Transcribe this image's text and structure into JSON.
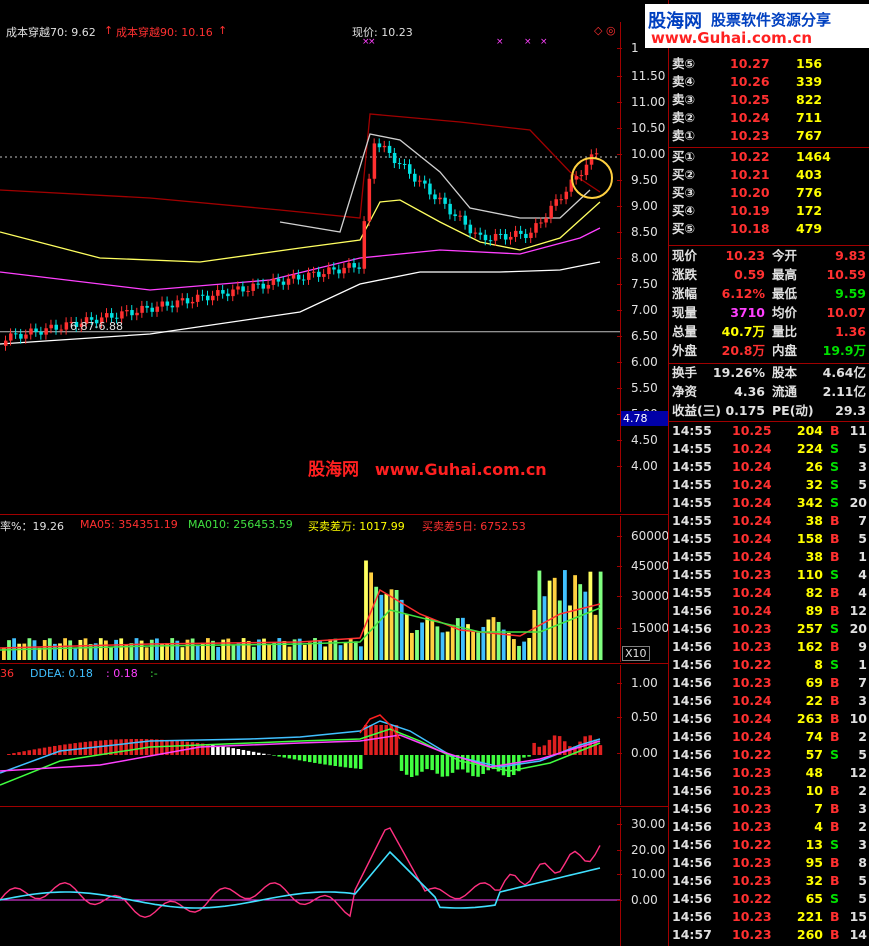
{
  "price_header": {
    "cost70": "成本穿越70: 9.62",
    "cost90": "成本穿越90: 10.16",
    "current": "现价: 10.23",
    "arrow": "↑"
  },
  "price_axis": [
    "1",
    "11.50",
    "11.00",
    "10.50",
    "10.00",
    "9.50",
    "9.00",
    "8.50",
    "8.00",
    "7.50",
    "7.00",
    "6.50",
    "6.00",
    "5.50",
    "5.00",
    "4.50",
    "4.00"
  ],
  "price_badge": "4.78",
  "low_label": "6.87-6.88",
  "watermark": {
    "brand": "股海网",
    "url": "www.Guhai.com.cn"
  },
  "logo": {
    "brand": "股海网",
    "slogan": "股票软件资源分享",
    "url": "www.Guhai.com.cn"
  },
  "volume_header": {
    "rate": "率%：19.26",
    "ma05": "MA05: 354351.19",
    "ma010": "MA010: 256453.59",
    "buysell": "买卖差万: 1017.99",
    "buysell5": "买卖差5日: 6752.53"
  },
  "volume_axis": [
    "60000",
    "45000",
    "30000",
    "15000"
  ],
  "volume_badge": "X10",
  "ddx_header": {
    "a": "36",
    "ddea": "DDEA: 0.18",
    "b": ": 0.18",
    "c": ":-"
  },
  "ddx_axis": [
    "1.00",
    "0.50",
    "0.00"
  ],
  "osc_axis": [
    "30.00",
    "20.00",
    "10.00",
    "0.00"
  ],
  "order_book": [
    {
      "label": "卖⑤",
      "price": "10.27",
      "vol": "156"
    },
    {
      "label": "卖④",
      "price": "10.26",
      "vol": "339"
    },
    {
      "label": "卖③",
      "price": "10.25",
      "vol": "822"
    },
    {
      "label": "卖②",
      "price": "10.24",
      "vol": "711"
    },
    {
      "label": "卖①",
      "price": "10.23",
      "vol": "767"
    },
    {
      "label": "买①",
      "price": "10.22",
      "vol": "1464"
    },
    {
      "label": "买②",
      "price": "10.21",
      "vol": "403"
    },
    {
      "label": "买③",
      "price": "10.20",
      "vol": "776"
    },
    {
      "label": "买④",
      "price": "10.19",
      "vol": "172"
    },
    {
      "label": "买⑤",
      "price": "10.18",
      "vol": "479"
    }
  ],
  "quote": [
    {
      "k1": "现价",
      "v1": "10.23",
      "c1": "#ff3030",
      "k2": "今开",
      "v2": "9.83",
      "c2": "#ff3030"
    },
    {
      "k1": "涨跌",
      "v1": "0.59",
      "c1": "#ff3030",
      "k2": "最高",
      "v2": "10.59",
      "c2": "#ff3030"
    },
    {
      "k1": "涨幅",
      "v1": "6.12%",
      "c1": "#ff3030",
      "k2": "最低",
      "v2": "9.59",
      "c2": "#00e000"
    },
    {
      "k1": "现量",
      "v1": "3710",
      "c1": "#ff40ff",
      "k2": "均价",
      "v2": "10.07",
      "c2": "#ff3030"
    },
    {
      "k1": "总量",
      "v1": "40.7万",
      "c1": "#ffff00",
      "k2": "量比",
      "v2": "1.36",
      "c2": "#ff3030"
    },
    {
      "k1": "外盘",
      "v1": "20.8万",
      "c1": "#ff3030",
      "k2": "内盘",
      "v2": "19.9万",
      "c2": "#00e000"
    }
  ],
  "fundamentals": [
    {
      "k1": "换手",
      "v1": "19.26%",
      "k2": "股本",
      "v2": "4.64亿"
    },
    {
      "k1": "净资",
      "v1": "4.36",
      "k2": "流通",
      "v2": "2.11亿"
    },
    {
      "k1": "收益(三)",
      "v1": "0.175",
      "k2": "PE(动)",
      "v2": "29.3"
    }
  ],
  "ticks": [
    {
      "t": "14:55",
      "p": "10.25",
      "v": "204",
      "d": "B",
      "n": "11"
    },
    {
      "t": "14:55",
      "p": "10.24",
      "v": "224",
      "d": "S",
      "n": "5"
    },
    {
      "t": "14:55",
      "p": "10.24",
      "v": "26",
      "d": "S",
      "n": "3"
    },
    {
      "t": "14:55",
      "p": "10.24",
      "v": "32",
      "d": "S",
      "n": "5"
    },
    {
      "t": "14:55",
      "p": "10.24",
      "v": "342",
      "d": "S",
      "n": "20"
    },
    {
      "t": "14:55",
      "p": "10.24",
      "v": "38",
      "d": "B",
      "n": "7"
    },
    {
      "t": "14:55",
      "p": "10.24",
      "v": "158",
      "d": "B",
      "n": "5"
    },
    {
      "t": "14:55",
      "p": "10.24",
      "v": "38",
      "d": "B",
      "n": "1"
    },
    {
      "t": "14:55",
      "p": "10.23",
      "v": "110",
      "d": "S",
      "n": "4"
    },
    {
      "t": "14:55",
      "p": "10.24",
      "v": "82",
      "d": "B",
      "n": "4"
    },
    {
      "t": "14:56",
      "p": "10.24",
      "v": "89",
      "d": "B",
      "n": "12"
    },
    {
      "t": "14:56",
      "p": "10.23",
      "v": "257",
      "d": "S",
      "n": "20"
    },
    {
      "t": "14:56",
      "p": "10.23",
      "v": "162",
      "d": "B",
      "n": "9"
    },
    {
      "t": "14:56",
      "p": "10.22",
      "v": "8",
      "d": "S",
      "n": "1"
    },
    {
      "t": "14:56",
      "p": "10.23",
      "v": "69",
      "d": "B",
      "n": "7"
    },
    {
      "t": "14:56",
      "p": "10.24",
      "v": "22",
      "d": "B",
      "n": "3"
    },
    {
      "t": "14:56",
      "p": "10.24",
      "v": "263",
      "d": "B",
      "n": "10"
    },
    {
      "t": "14:56",
      "p": "10.24",
      "v": "74",
      "d": "B",
      "n": "2"
    },
    {
      "t": "14:56",
      "p": "10.22",
      "v": "57",
      "d": "S",
      "n": "5"
    },
    {
      "t": "14:56",
      "p": "10.23",
      "v": "48",
      "d": "",
      "n": "12"
    },
    {
      "t": "14:56",
      "p": "10.23",
      "v": "10",
      "d": "B",
      "n": "2"
    },
    {
      "t": "14:56",
      "p": "10.23",
      "v": "7",
      "d": "B",
      "n": "3"
    },
    {
      "t": "14:56",
      "p": "10.23",
      "v": "4",
      "d": "B",
      "n": "2"
    },
    {
      "t": "14:56",
      "p": "10.22",
      "v": "13",
      "d": "S",
      "n": "3"
    },
    {
      "t": "14:56",
      "p": "10.23",
      "v": "95",
      "d": "B",
      "n": "8"
    },
    {
      "t": "14:56",
      "p": "10.23",
      "v": "32",
      "d": "B",
      "n": "5"
    },
    {
      "t": "14:56",
      "p": "10.22",
      "v": "65",
      "d": "S",
      "n": "5"
    },
    {
      "t": "14:56",
      "p": "10.23",
      "v": "221",
      "d": "B",
      "n": "15"
    },
    {
      "t": "14:57",
      "p": "10.23",
      "v": "260",
      "d": "B",
      "n": "14"
    }
  ]
}
